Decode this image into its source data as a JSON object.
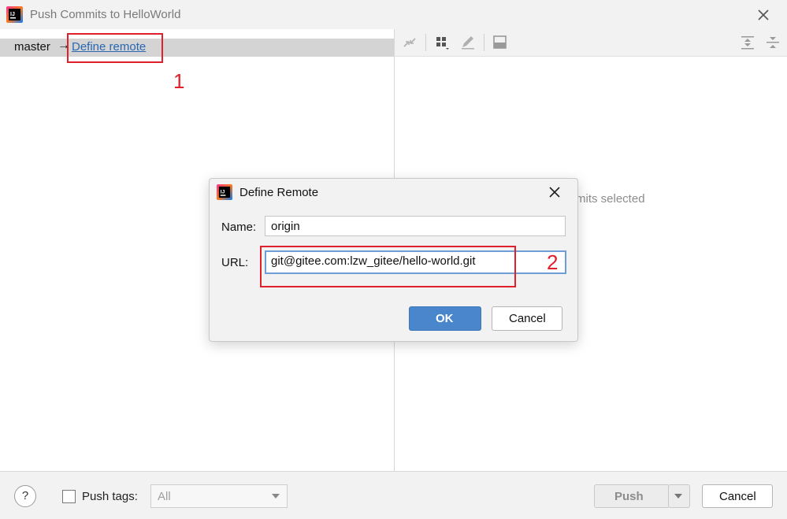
{
  "window": {
    "title": "Push Commits to HelloWorld"
  },
  "left_pane": {
    "branch": "master",
    "arrow": "→",
    "define_remote_link": "Define remote"
  },
  "right_pane": {
    "empty_text": "mits selected"
  },
  "toolbar_icons": [
    "collapse-arrows-icon",
    "group-by-icon",
    "edit-icon",
    "preview-panel-icon",
    "expand-all-icon",
    "collapse-all-icon"
  ],
  "bottom_bar": {
    "help": "?",
    "push_tags_label": "Push tags:",
    "push_tags_select": "All",
    "push_button": "Push",
    "cancel_button": "Cancel"
  },
  "dialog": {
    "title": "Define Remote",
    "name_label": "Name:",
    "name_value": "origin",
    "url_label": "URL:",
    "url_value": "git@gitee.com:lzw_gitee/hello-world.git",
    "ok_button": "OK",
    "cancel_button": "Cancel"
  },
  "annotations": {
    "step1": "1",
    "step2": "2",
    "color": "#e0202a"
  },
  "colors": {
    "link": "#2a67b1",
    "ok_button": "#4a86cc",
    "focus_border": "#6f9ed6"
  }
}
